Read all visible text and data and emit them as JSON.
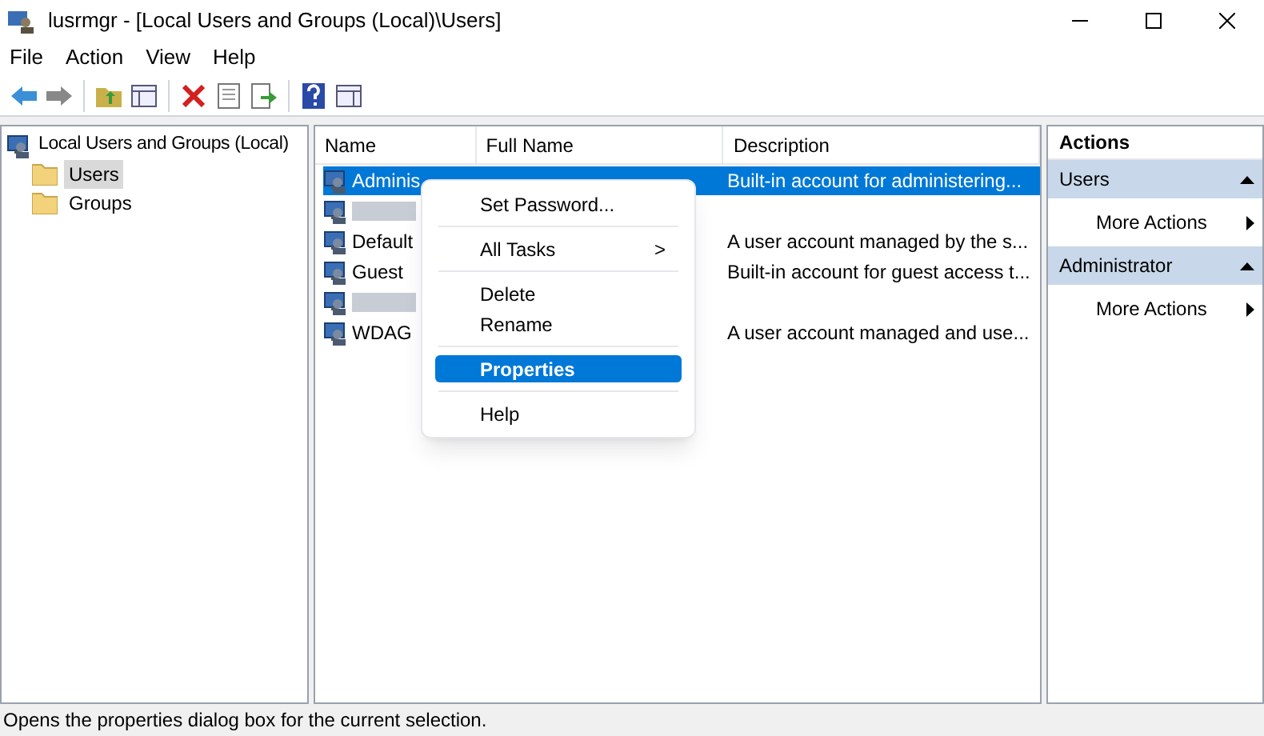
{
  "window": {
    "title": "lusrmgr - [Local Users and Groups (Local)\\Users]"
  },
  "menu": [
    "File",
    "Action",
    "View",
    "Help"
  ],
  "tree": {
    "label": "Local Users and Groups (Local)",
    "children": [
      {
        "label": "Users",
        "selected": true
      },
      {
        "label": "Groups",
        "selected": false
      }
    ]
  },
  "table": {
    "columns": [
      "Name",
      "Full Name",
      "Description"
    ],
    "rows": [
      {
        "kind": "user",
        "name": "Adminis",
        "description": "Built-in account for administering...",
        "selected": true
      },
      {
        "kind": "redacted",
        "selected": false
      },
      {
        "kind": "user",
        "name": "Default",
        "description": "A user account managed by the s...",
        "selected": false
      },
      {
        "kind": "user",
        "name": "Guest",
        "description": "Built-in account for guest access t...",
        "selected": false
      },
      {
        "kind": "redacted",
        "selected": false
      },
      {
        "kind": "user",
        "name": "WDAG",
        "description": "A user account managed and use...",
        "selected": false
      }
    ]
  },
  "context_menu": [
    {
      "kind": "item",
      "label": "Set Password...",
      "selected": false
    },
    {
      "kind": "separator"
    },
    {
      "kind": "submenu",
      "label": "All Tasks",
      "arrow": ">",
      "selected": false
    },
    {
      "kind": "separator"
    },
    {
      "kind": "item",
      "label": "Delete",
      "selected": false
    },
    {
      "kind": "item",
      "label": "Rename",
      "selected": false
    },
    {
      "kind": "separator"
    },
    {
      "kind": "item",
      "label": "Properties",
      "selected": true
    },
    {
      "kind": "separator"
    },
    {
      "kind": "item",
      "label": "Help",
      "selected": false
    }
  ],
  "actions": {
    "title": "Actions",
    "sections": [
      {
        "header": "Users",
        "items": [
          "More Actions"
        ]
      },
      {
        "header": "Administrator",
        "items": [
          "More Actions"
        ]
      }
    ]
  },
  "status_bar": "Opens the properties dialog box for the current selection."
}
